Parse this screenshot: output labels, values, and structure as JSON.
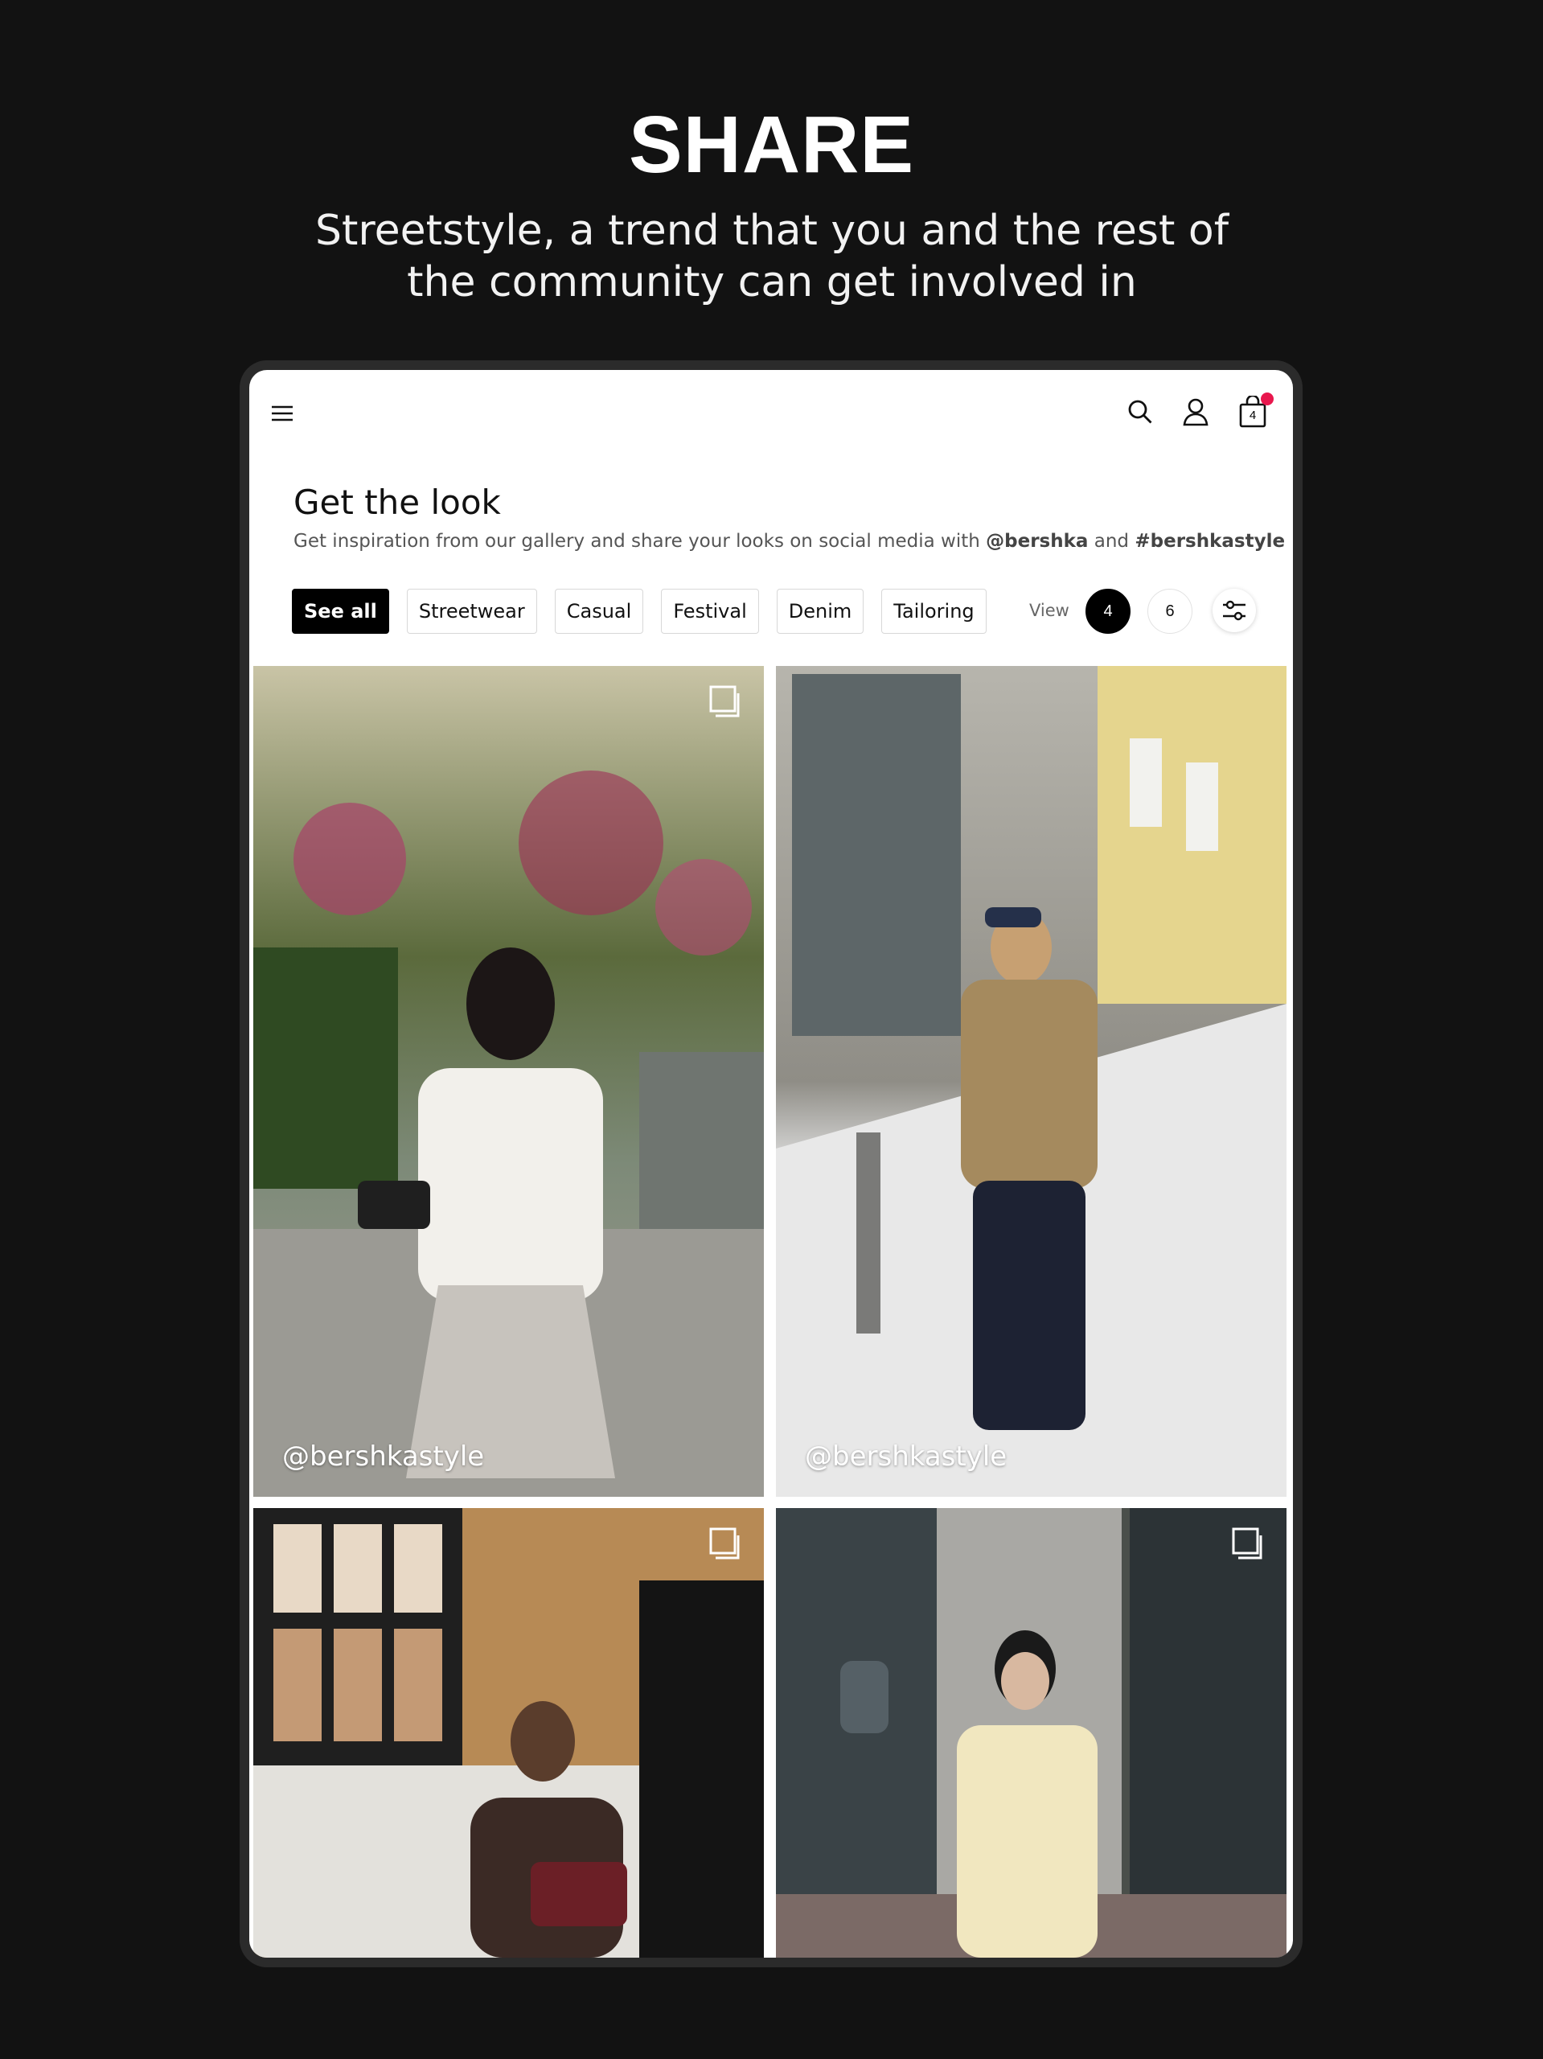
{
  "hero": {
    "title": "SHARE",
    "subtitle_line1": "Streetstyle, a trend that you and the rest of",
    "subtitle_line2": "the community can get involved in"
  },
  "app": {
    "bag_count": "4",
    "page_title": "Get the look",
    "description_prefix": "Get inspiration from our gallery and share your looks on social media with",
    "handle_mention": "@bershka",
    "description_and": "and",
    "hashtag": "#bershkastyle",
    "filters": [
      "See all",
      "Streetwear",
      "Casual",
      "Festival",
      "Denim",
      "Tailoring"
    ],
    "active_filter": "See all",
    "view_label": "View",
    "view_options": [
      "4",
      "6"
    ],
    "active_view": "4",
    "posts": [
      {
        "handle": "@bershkastyle"
      },
      {
        "handle": "@bershkastyle"
      },
      {
        "handle": ""
      },
      {
        "handle": ""
      }
    ]
  },
  "colors": {
    "background": "#121212",
    "accent_dot": "#e8174d",
    "chip_active": "#000000"
  },
  "icons": [
    "menu-icon",
    "search-icon",
    "user-icon",
    "shopping-bag-icon",
    "filter-sliders-icon",
    "multiple-images-icon"
  ]
}
